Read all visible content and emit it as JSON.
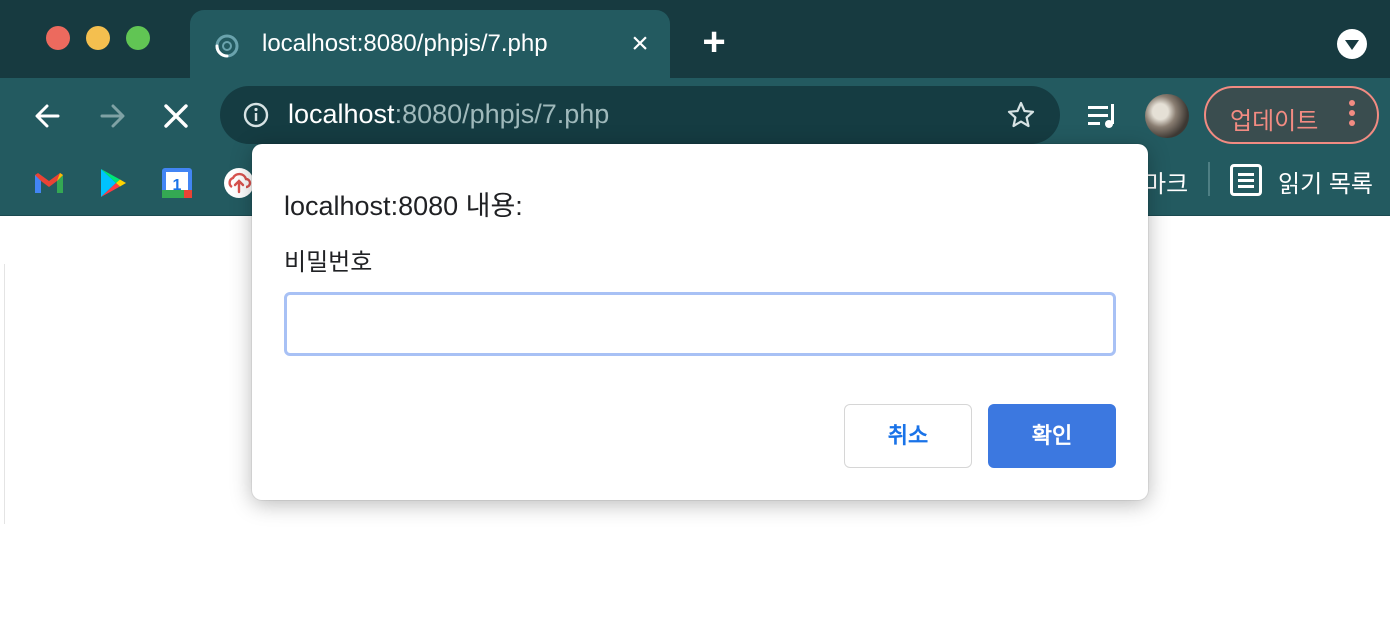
{
  "tab": {
    "title": "localhost:8080/phpjs/7.php",
    "icon": "loading-spinner-icon"
  },
  "omnibox": {
    "host": "localhost",
    "rest": ":8080/phpjs/7.php"
  },
  "toolbar": {
    "update_label": "업데이트"
  },
  "bookmarks": {
    "visible_suffix": "마크",
    "reading_list": "읽기 목록",
    "icons": [
      "gmail-icon",
      "google-play-icon",
      "google-calendar-icon",
      "cloud-upload-icon"
    ]
  },
  "dialog": {
    "title": "localhost:8080 내용:",
    "message": "비밀번호",
    "input_value": "",
    "cancel_label": "취소",
    "ok_label": "확인"
  },
  "colors": {
    "tabstrip": "#173a40",
    "toolbar": "#235a60",
    "update_accent": "#f28b82",
    "ok_button": "#3c78e0"
  }
}
